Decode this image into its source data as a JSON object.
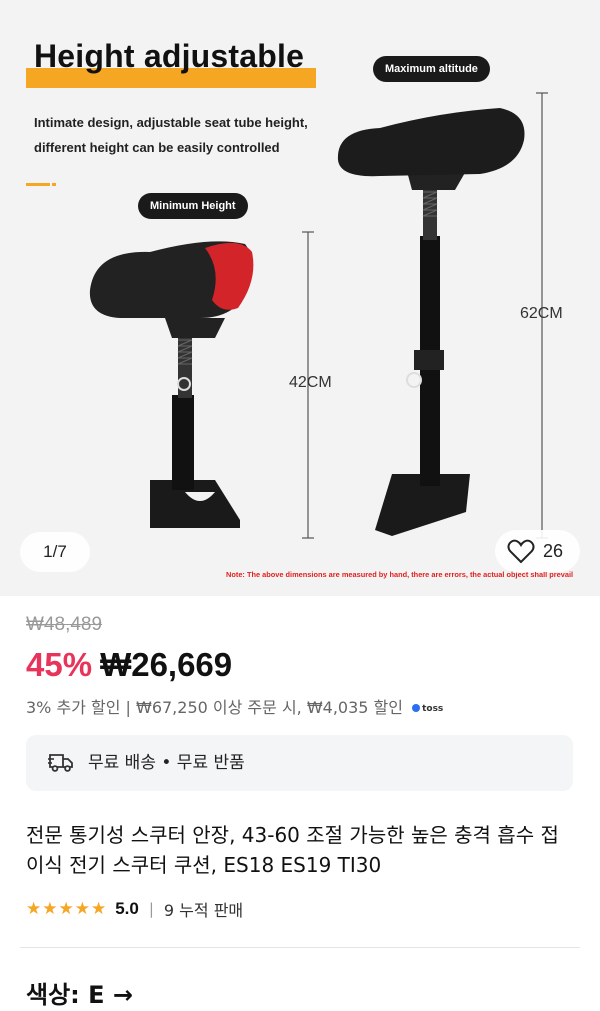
{
  "gallery": {
    "headline": "Height adjustable",
    "description": "Intimate design, adjustable seat tube height, different height can be easily controlled",
    "label_max": "Maximum altitude",
    "label_min": "Minimum Height",
    "measure_min": "42CM",
    "measure_max": "62CM",
    "note": "Note: The above dimensions are measured by hand, there are errors, the actual object shall prevail",
    "counter": "1/7",
    "like_count": "26",
    "accent_color": "#f5a623"
  },
  "price": {
    "original": "₩48,489",
    "discount": "45%",
    "current": "₩26,669",
    "extra_discount": "3% 추가 할인 | ₩67,250 이상 주문 시, ₩4,035 할인",
    "pay_badge": "toss",
    "discount_color": "#e8335a"
  },
  "shipping": {
    "icon": "truck-icon",
    "text": "무료 배송 • 무료 반품"
  },
  "product": {
    "title": "전문 통기성 스쿠터 안장, 43-60 조절 가능한 높은 충격 흡수 접이식 전기 스쿠터 쿠션, ES18 ES19 TI30",
    "stars": "★★★★★",
    "rating": "5.0",
    "separator": "|",
    "sold": "9 누적 판매"
  },
  "options": {
    "color_label": "색상: E →"
  }
}
